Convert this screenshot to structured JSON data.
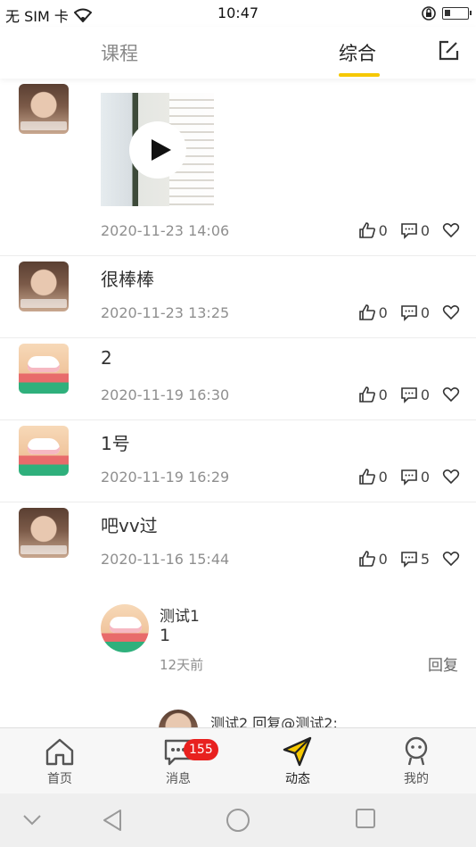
{
  "status_bar": {
    "carrier": "无 SIM 卡",
    "time": "10:47"
  },
  "header": {
    "tabs": [
      {
        "label": "课程",
        "active": false
      },
      {
        "label": "综合",
        "active": true
      }
    ],
    "accent_color": "#f6c800"
  },
  "posts": [
    {
      "text": "",
      "has_video": true,
      "time": "2020-11-23 14:06",
      "likes": "0",
      "comments": "0",
      "avatar": "person"
    },
    {
      "text": "很棒棒",
      "has_video": false,
      "time": "2020-11-23 13:25",
      "likes": "0",
      "comments": "0",
      "avatar": "person"
    },
    {
      "text": "2",
      "has_video": false,
      "time": "2020-11-19 16:30",
      "likes": "0",
      "comments": "0",
      "avatar": "shoe"
    },
    {
      "text": "1号",
      "has_video": false,
      "time": "2020-11-19 16:29",
      "likes": "0",
      "comments": "0",
      "avatar": "shoe"
    },
    {
      "text": "吧vv过",
      "has_video": false,
      "time": "2020-11-16 15:44",
      "likes": "0",
      "comments": "5",
      "avatar": "person"
    }
  ],
  "comment": {
    "name": "测试1",
    "text": "1",
    "time": "12天前",
    "reply_label": "回复"
  },
  "sub_reply": {
    "text": "测试2 回复@测试2:"
  },
  "bottom_nav": {
    "items": [
      {
        "label": "首页",
        "icon": "home-icon"
      },
      {
        "label": "消息",
        "icon": "message-icon"
      },
      {
        "label": "动态",
        "icon": "send-icon",
        "active": true
      },
      {
        "label": "我的",
        "icon": "profile-icon"
      }
    ],
    "message_badge": "155",
    "badge_color": "#e8211f"
  }
}
